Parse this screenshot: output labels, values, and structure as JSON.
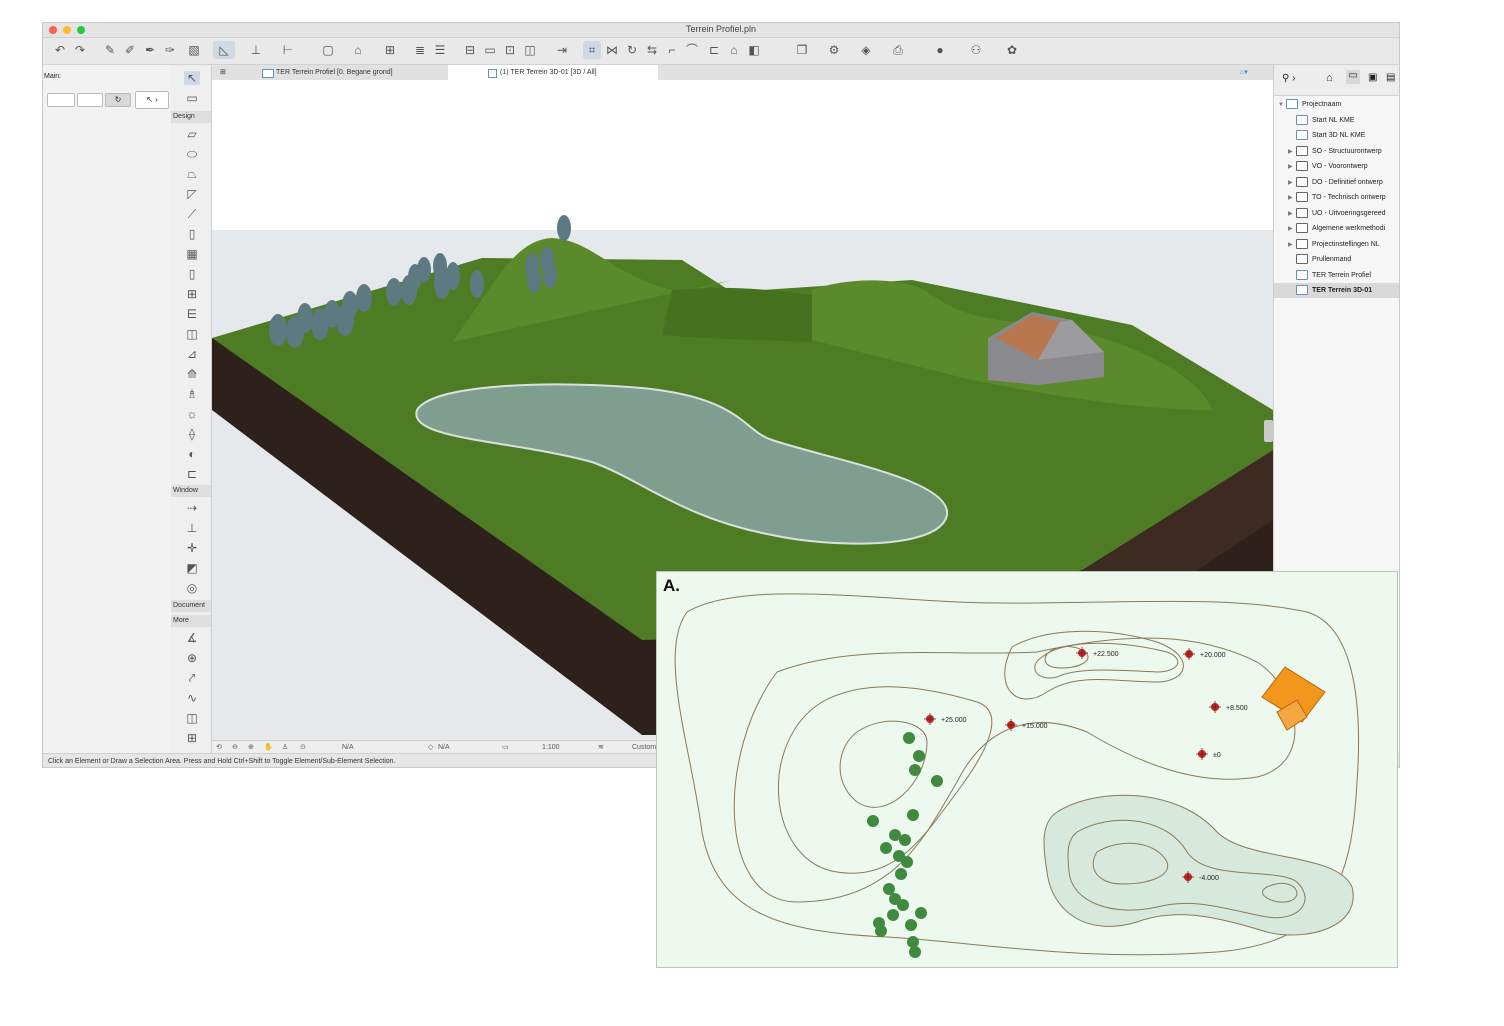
{
  "window": {
    "title": "Terrein Profiel.pln"
  },
  "left_palette": {
    "main_label": "Main:"
  },
  "toolbox": {
    "sections": {
      "design": "Design",
      "window": "Window",
      "document": "Document",
      "more": "More"
    }
  },
  "tabs": [
    {
      "label": "TER Terrein Profiel [0. Begane grond]",
      "active": false
    },
    {
      "label": "(1) TER Terrein 3D-01 [3D / All]",
      "active": true
    }
  ],
  "navigator": {
    "items": [
      {
        "label": "Projectnaam",
        "level": 0,
        "expanded": true,
        "selected": false
      },
      {
        "label": "Start NL KME",
        "level": 1,
        "expanded": false,
        "selected": false
      },
      {
        "label": "Start 3D NL KME",
        "level": 1,
        "expanded": false,
        "selected": false
      },
      {
        "label": "SO - Structuurontwerp",
        "level": 1,
        "expanded": false,
        "selected": false
      },
      {
        "label": "VO - Voorontwerp",
        "level": 1,
        "expanded": false,
        "selected": false
      },
      {
        "label": "DO - Definitief ontwerp",
        "level": 1,
        "expanded": false,
        "selected": false
      },
      {
        "label": "TO - Technisch ontwerp",
        "level": 1,
        "expanded": false,
        "selected": false
      },
      {
        "label": "UO - Uitvoeringsgereed",
        "level": 1,
        "expanded": false,
        "selected": false
      },
      {
        "label": "Algemene werkmethodi",
        "level": 1,
        "expanded": false,
        "selected": false
      },
      {
        "label": "Projectinstellingen NL",
        "level": 1,
        "expanded": false,
        "selected": false
      },
      {
        "label": "Prullenmand",
        "level": 1,
        "expanded": false,
        "selected": false
      },
      {
        "label": "TER Terrein Profiel",
        "level": 1,
        "expanded": false,
        "selected": false
      },
      {
        "label": "TER Terrein 3D-01",
        "level": 1,
        "expanded": false,
        "selected": true
      }
    ]
  },
  "viewport_bar": {
    "na_1": "N/A",
    "na_2": "N/A",
    "scale": "1:100",
    "custom": "Custom"
  },
  "status_bar": {
    "text": "Click an Element or Draw a Selection Area. Press and Hold Ctrl+Shift to Toggle Element/Sub-Element Selection."
  },
  "inset_plan": {
    "label": "A.",
    "spot_levels": [
      "+22.500",
      "+20.000",
      "+25.000",
      "+15.000",
      "+8.500",
      "±0",
      "-4.000"
    ]
  },
  "colors": {
    "grass": "#4f7d24",
    "grass_dark": "#3f6a1c",
    "water": "#7f9e8f",
    "soil": "#3b2a22",
    "roof": "#b9774f",
    "tree": "#5d7a82",
    "plan_bg": "#edf8ee",
    "contour": "#8a7a5a",
    "plan_tree": "#3f8a3f",
    "plan_house": "#f2961e",
    "spot_marker": "#e21b1b"
  }
}
